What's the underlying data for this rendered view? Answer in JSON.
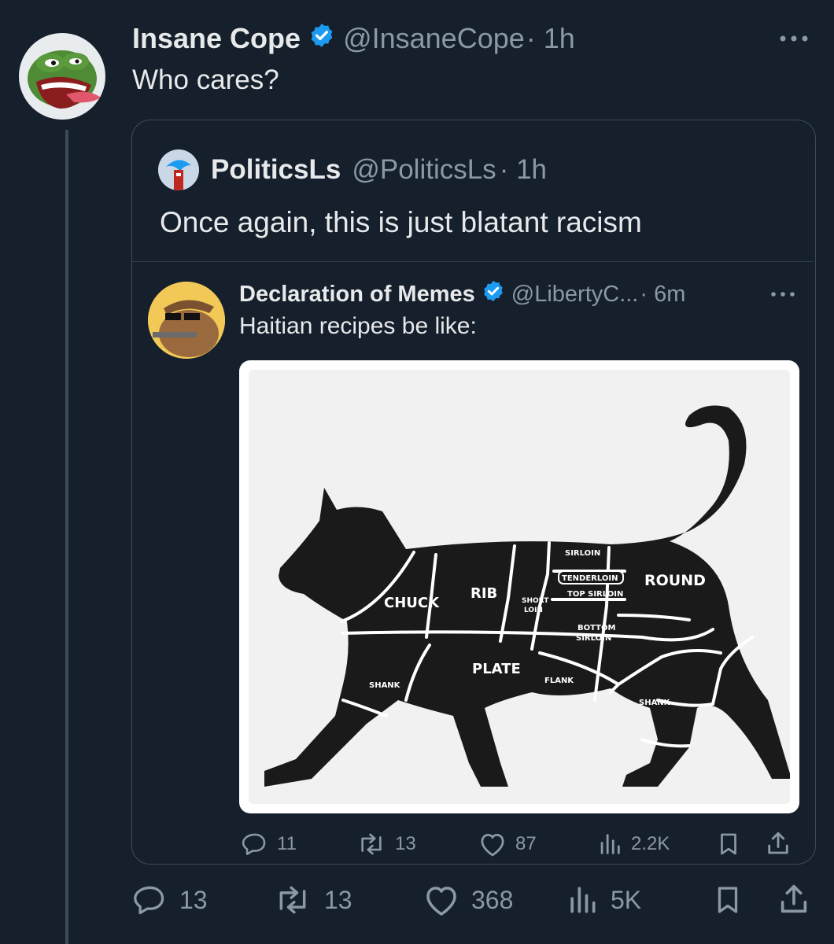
{
  "main_tweet": {
    "author_name": "Insane Cope",
    "handle": "@InsaneCope",
    "time": "· 1h",
    "text": "Who cares?",
    "more_icon": "more-dots-icon",
    "stats": {
      "replies": "13",
      "retweets": "13",
      "likes": "368",
      "views": "5K"
    }
  },
  "quoted_tweet": {
    "author_name": "PoliticsLs",
    "handle": "@PoliticsLs",
    "time": "· 1h",
    "text": "Once again, this is just blatant racism"
  },
  "nested_tweet": {
    "author_name": "Declaration of Memes",
    "handle": "@LibertyC...",
    "time": "· 6m",
    "text": "Haitian recipes be like:",
    "stats": {
      "replies": "11",
      "retweets": "13",
      "likes": "87",
      "views": "2.2K"
    }
  },
  "meme_labels": {
    "chuck": "CHUCK",
    "rib": "RIB",
    "short_loin_1": "SHORT",
    "short_loin_2": "LOIN",
    "sirloin": "SIRLOIN",
    "tenderloin": "TENDERLOIN",
    "top_sirloin": "TOP SIRLOIN",
    "bottom_sirloin_1": "BOTTOM",
    "bottom_sirloin_2": "SIRLOIN",
    "round": "ROUND",
    "plate": "PLATE",
    "flank": "FLANK",
    "shank_front": "SHANK",
    "shank_back": "SHANK"
  },
  "colors": {
    "background": "#16202c",
    "text": "#e7e9ea",
    "muted": "#8b98a5",
    "verified": "#1d9bf0",
    "border": "#3d4a58"
  }
}
